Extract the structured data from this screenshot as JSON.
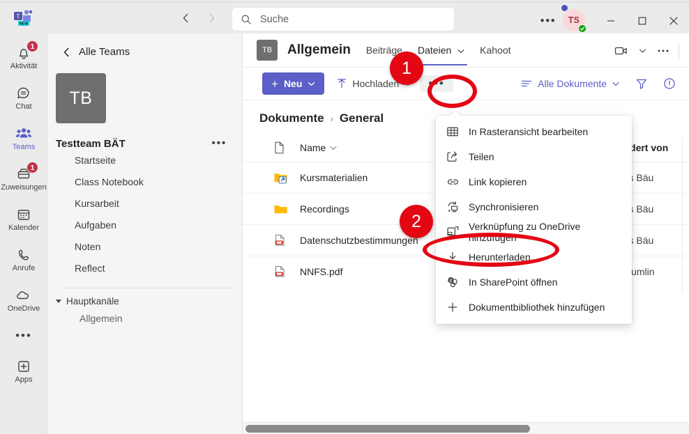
{
  "app": {
    "name": "Microsoft Teams",
    "logo_badge": "NEW",
    "accent_color": "#5b5fc7",
    "annotation_color": "#e30613"
  },
  "titlebar": {
    "back_icon": "chevron-left-icon",
    "forward_icon": "chevron-right-icon",
    "search": {
      "icon": "search-icon",
      "placeholder": "Suche",
      "value": ""
    },
    "more_label": "•••",
    "avatar_initials": "TS",
    "presence_status": "available",
    "minimize_label": "─",
    "maximize_label": "□",
    "close_label": "✕"
  },
  "rail": {
    "items": [
      {
        "label": "Aktivität",
        "icon": "bell-icon",
        "badge": "1",
        "active": false
      },
      {
        "label": "Chat",
        "icon": "chat-icon",
        "badge": "",
        "active": false
      },
      {
        "label": "Teams",
        "icon": "teams-icon",
        "badge": "",
        "active": true
      },
      {
        "label": "Zuweisungen",
        "icon": "assignments-icon",
        "badge": "1",
        "active": false
      },
      {
        "label": "Kalender",
        "icon": "calendar-icon",
        "badge": "",
        "active": false
      },
      {
        "label": "Anrufe",
        "icon": "phone-icon",
        "badge": "",
        "active": false
      },
      {
        "label": "OneDrive",
        "icon": "cloud-icon",
        "badge": "",
        "active": false
      }
    ],
    "overflow_label": "•••",
    "apps": {
      "label": "Apps",
      "icon": "apps-plus-icon"
    }
  },
  "teampanel": {
    "back_label": "Alle Teams",
    "team_avatar_initials": "TB",
    "team_name": "Testteam BÄT",
    "team_more_label": "•••",
    "apps": [
      "Startseite",
      "Class Notebook",
      "Kursarbeit",
      "Aufgaben",
      "Noten",
      "Reflect"
    ],
    "group_label": "Hauptkanäle",
    "channels": [
      "Allgemein"
    ]
  },
  "channel": {
    "avatar_initials": "TB",
    "title": "Allgemein",
    "tabs": [
      {
        "label": "Beiträge",
        "active": false,
        "chevron": false
      },
      {
        "label": "Dateien",
        "active": true,
        "chevron": true
      },
      {
        "label": "Kahoot",
        "active": false,
        "chevron": false
      }
    ],
    "header_icons": [
      "video-camera-icon",
      "chevron-down-icon",
      "more-horizontal-icon"
    ]
  },
  "toolbar": {
    "new_label": "Neu",
    "new_plus": "+",
    "upload_label": "Hochladen",
    "more_label": "•••",
    "view_label": "Alle Dokumente",
    "filter_icon": "filter-icon",
    "info_icon": "info-icon"
  },
  "breadcrumb": {
    "items": [
      "Dokumente",
      "General"
    ],
    "separator": "›"
  },
  "files": {
    "columns": {
      "icon": "document-icon",
      "name": "Name",
      "modified_by": "Geändert von"
    },
    "rows": [
      {
        "name": "Kursmaterialien",
        "icon": "folder-shortcut-icon",
        "modified_by": "Tobias Bäu"
      },
      {
        "name": "Recordings",
        "icon": "folder-icon",
        "modified_by": "Tobias Bäu"
      },
      {
        "name": "Datenschutzbestimmungen",
        "icon": "pdf-icon",
        "modified_by": "Tobias Bäu"
      },
      {
        "name": "NNFS.pdf",
        "icon": "pdf-icon",
        "modified_by": "T Baeumlin"
      }
    ]
  },
  "context_menu": {
    "items": [
      {
        "label": "In Rasteransicht bearbeiten",
        "icon": "grid-edit-icon"
      },
      {
        "label": "Teilen",
        "icon": "share-icon"
      },
      {
        "label": "Link kopieren",
        "icon": "link-icon"
      },
      {
        "label": "Synchronisieren",
        "icon": "sync-icon"
      },
      {
        "label": "Verknüpfung zu OneDrive hinzufügen",
        "icon": "onedrive-shortcut-icon"
      },
      {
        "label": "Herunterladen",
        "icon": "download-icon"
      },
      {
        "label": "In SharePoint öffnen",
        "icon": "sharepoint-icon"
      },
      {
        "label": "Dokumentbibliothek hinzufügen",
        "icon": "plus-icon"
      }
    ]
  },
  "annotations": [
    {
      "number": "1",
      "target": "toolbar-more-button"
    },
    {
      "number": "2",
      "target": "context-menu-item-download"
    }
  ]
}
